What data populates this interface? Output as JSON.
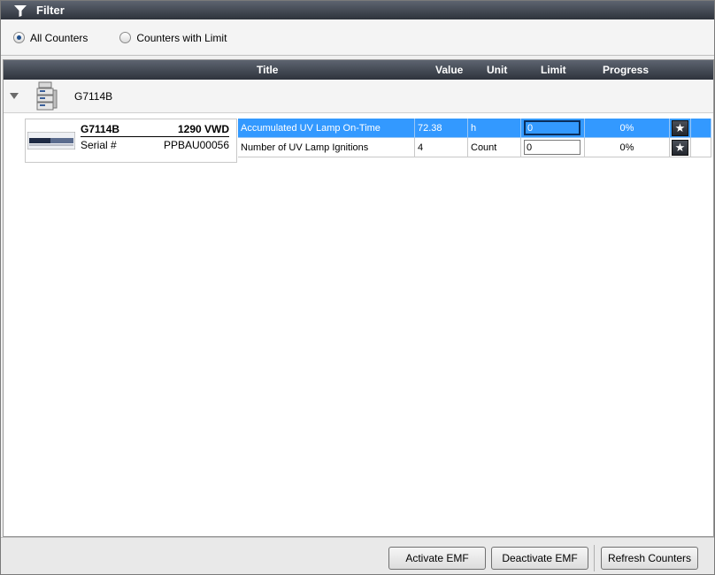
{
  "filter": {
    "title": "Filter",
    "options": [
      {
        "label": "All Counters",
        "checked": true
      },
      {
        "label": "Counters with Limit",
        "checked": false
      }
    ]
  },
  "columns": {
    "title": "Title",
    "value": "Value",
    "unit": "Unit",
    "limit": "Limit",
    "progress": "Progress"
  },
  "group": {
    "label": "G7114B"
  },
  "module": {
    "model": "G7114B",
    "name": "1290 VWD",
    "serial_label": "Serial #",
    "serial_value": "PPBAU00056"
  },
  "rows": [
    {
      "title": "Accumulated UV Lamp On-Time",
      "value": "72.38",
      "unit": "h",
      "limit": "0",
      "progress": "0%",
      "selected": true
    },
    {
      "title": "Number of UV Lamp Ignitions",
      "value": "4",
      "unit": "Count",
      "limit": "0",
      "progress": "0%",
      "selected": false
    }
  ],
  "buttons": {
    "activate": "Activate EMF",
    "deactivate": "Deactivate EMF",
    "refresh": "Refresh Counters"
  },
  "icons": {
    "filter": "funnel-icon",
    "star": "star-icon",
    "expander": "chevron-down-icon"
  },
  "colors": {
    "header_dark": "#2e333c",
    "selection": "#3399ff"
  }
}
